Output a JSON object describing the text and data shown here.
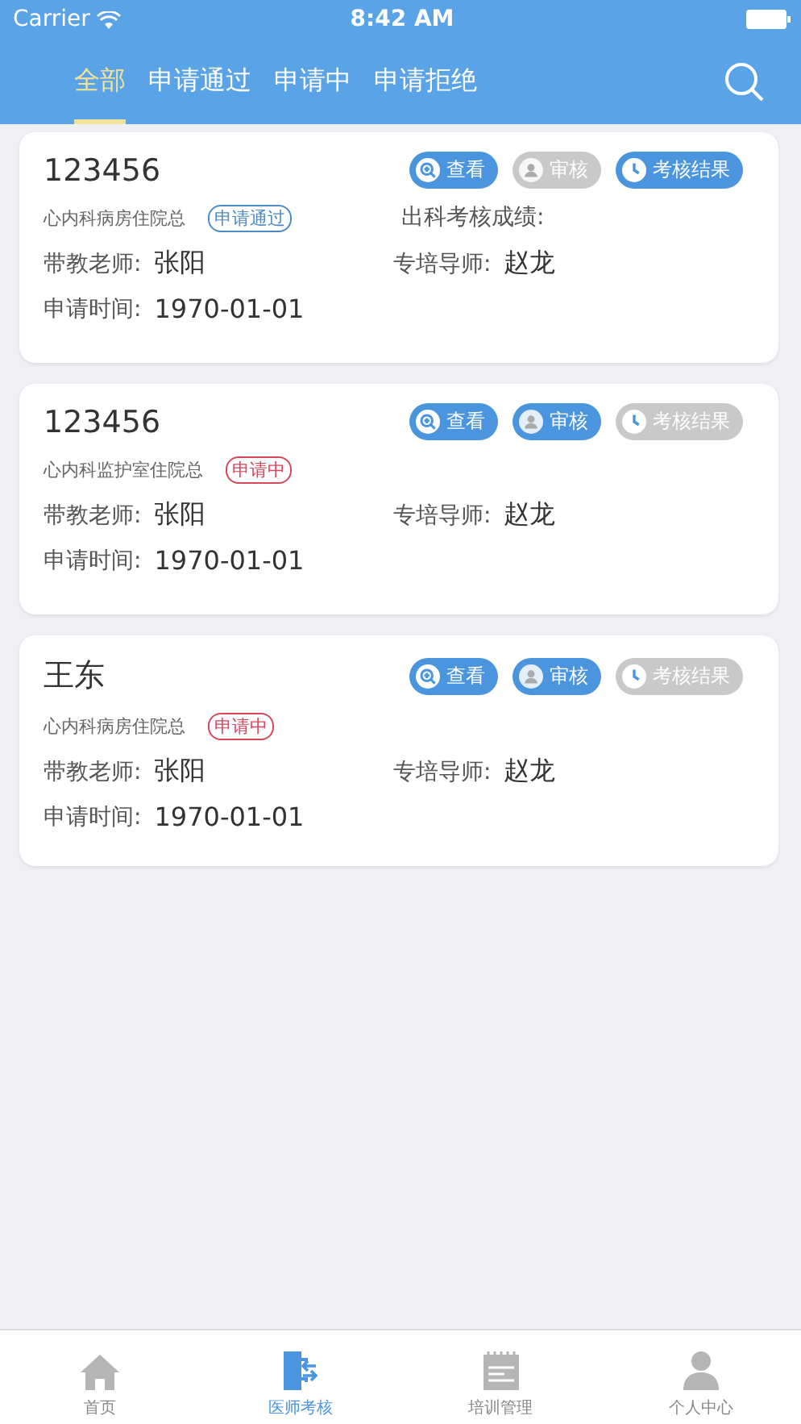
{
  "status_bar": {
    "carrier": "Carrier",
    "time": "8:42 AM"
  },
  "tabs": [
    {
      "label": "全部",
      "selected": true
    },
    {
      "label": "申请通过",
      "selected": false
    },
    {
      "label": "申请中",
      "selected": false
    },
    {
      "label": "申请拒绝",
      "selected": false
    }
  ],
  "cards": [
    {
      "title": "123456",
      "department": "心内科病房住院总",
      "status": {
        "label": "申请通过",
        "kind": "passed"
      },
      "score_label": "出科考核成绩:",
      "actions": [
        {
          "kind": "view",
          "label": "查看",
          "disabled": false
        },
        {
          "kind": "review",
          "label": "审核",
          "disabled": true
        },
        {
          "kind": "result",
          "label": "考核结果",
          "disabled": false
        }
      ],
      "teacher_label": "带教老师:",
      "teacher": "张阳",
      "mentor_label": "专培导师:",
      "mentor": "赵龙",
      "time_label": "申请时间:",
      "time": "1970-01-01"
    },
    {
      "title": "123456",
      "department": "心内科监护室住院总",
      "status": {
        "label": "申请中",
        "kind": "pending"
      },
      "actions": [
        {
          "kind": "view",
          "label": "查看",
          "disabled": false
        },
        {
          "kind": "review",
          "label": "审核",
          "disabled": false
        },
        {
          "kind": "result",
          "label": "考核结果",
          "disabled": true
        }
      ],
      "teacher_label": "带教老师:",
      "teacher": "张阳",
      "mentor_label": "专培导师:",
      "mentor": "赵龙",
      "time_label": "申请时间:",
      "time": "1970-01-01"
    },
    {
      "title": "王东",
      "department": "心内科病房住院总",
      "status": {
        "label": "申请中",
        "kind": "pending"
      },
      "actions": [
        {
          "kind": "view",
          "label": "查看",
          "disabled": false
        },
        {
          "kind": "review",
          "label": "审核",
          "disabled": false
        },
        {
          "kind": "result",
          "label": "考核结果",
          "disabled": true
        }
      ],
      "teacher_label": "带教老师:",
      "teacher": "张阳",
      "mentor_label": "专培导师:",
      "mentor": "赵龙",
      "time_label": "申请时间:",
      "time": "1970-01-01"
    }
  ],
  "bottom_nav": [
    {
      "kind": "home",
      "label": "首页",
      "selected": false
    },
    {
      "kind": "exam",
      "label": "医师考核",
      "selected": true
    },
    {
      "kind": "training",
      "label": "培训管理",
      "selected": false
    },
    {
      "kind": "profile",
      "label": "个人中心",
      "selected": false
    }
  ]
}
